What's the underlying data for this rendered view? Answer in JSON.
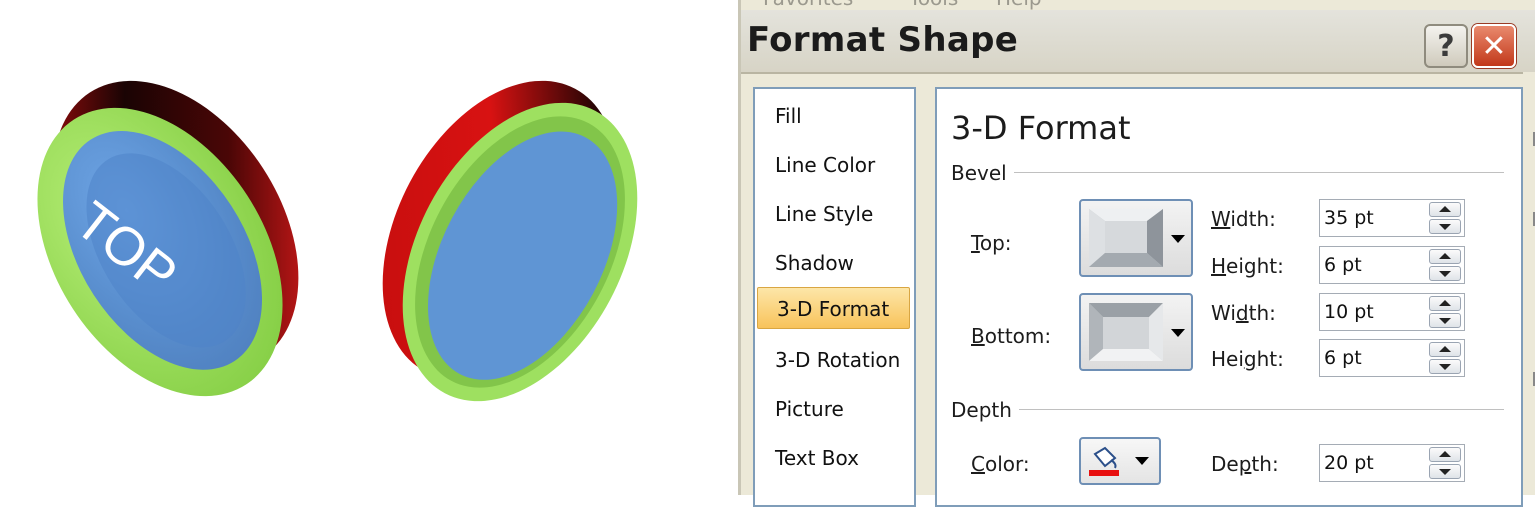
{
  "canvas": {
    "coin1_text": "TOP",
    "colors": {
      "rim": "#9bdc5a",
      "face": "#5b8fcf",
      "edge": "#d40f0f",
      "edge_dark": "#1a0404"
    }
  },
  "dialog": {
    "menu_fragments": [
      "Favorites",
      "Tools",
      "Help"
    ],
    "title": "Format Shape",
    "help_label": "?",
    "close_label": "✕",
    "nav": {
      "items": [
        {
          "label": "Fill"
        },
        {
          "label": "Line Color"
        },
        {
          "label": "Line Style"
        },
        {
          "label": "Shadow"
        },
        {
          "label": "3-D Format",
          "selected": true
        },
        {
          "label": "3-D Rotation"
        },
        {
          "label": "Picture"
        },
        {
          "label": "Text Box"
        }
      ]
    },
    "panel": {
      "title": "3-D Format",
      "bevel": {
        "group_label": "Bevel",
        "top_label": "Top:",
        "bottom_label": "Bottom:",
        "width_label": "Width:",
        "height_label": "Height:",
        "top_width": "35 pt",
        "top_height": "6 pt",
        "bottom_width": "10 pt",
        "bottom_height": "6 pt"
      },
      "depth": {
        "group_label": "Depth",
        "color_label": "Color:",
        "depth_label": "Depth:",
        "depth_value": "20 pt",
        "color": "#e81010"
      }
    }
  }
}
